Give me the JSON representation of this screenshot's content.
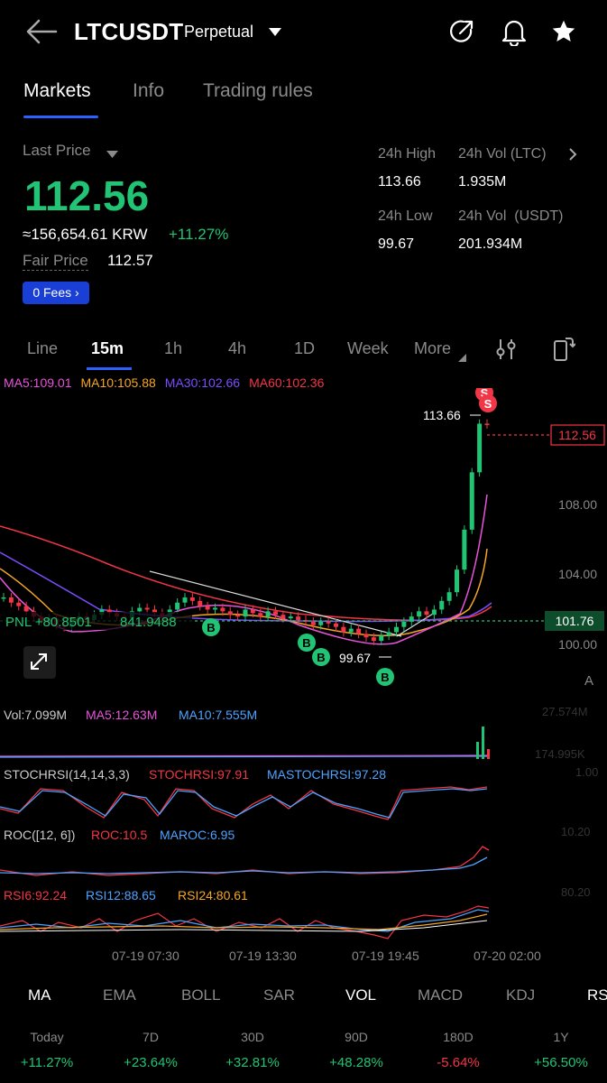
{
  "header": {
    "symbol": "LTCUSDT",
    "contract": "Perpetual"
  },
  "tabs": [
    "Markets",
    "Info",
    "Trading rules"
  ],
  "price": {
    "last_price_label": "Last Price",
    "last": "112.56",
    "krw": "≈156,654.61 KRW",
    "change": "+11.27%",
    "fair_label": "Fair Price",
    "fair": "112.57",
    "fees": "0 Fees"
  },
  "stats": {
    "high_label": "24h High",
    "high": "113.66",
    "vol_ltc_label": "24h Vol (LTC)",
    "vol_ltc": "1.935M",
    "low_label": "24h Low",
    "low": "99.67",
    "vol_usdt_label": "24h Vol  (USDT)",
    "vol_usdt": "201.934M"
  },
  "intervals": [
    "Line",
    "15m",
    "1h",
    "4h",
    "1D",
    "Week",
    "More"
  ],
  "ma_line": {
    "ma5": "MA5:109.01",
    "ma10": "MA10:105.88",
    "ma30": "MA30:102.66",
    "ma60": "MA60:102.36"
  },
  "chart_data": {
    "type": "candlestick",
    "y_ticks": [
      "108.00",
      "104.00",
      "100.00"
    ],
    "high_label": "113.66",
    "low_label": "99.67",
    "last_price_tag": "112.56",
    "pnl_label": "PNL +80.8501",
    "entry_value": "841.9488",
    "entry_price_tag": "101.76",
    "a_label": "A",
    "x_ticks": [
      "07-19 07:30",
      "07-19 13:30",
      "07-19 19:45",
      "07-20 02:00"
    ],
    "buy_marker": "B",
    "sell_marker": "S",
    "closes": [
      102.6,
      102.3,
      102.1,
      101.8,
      101.5,
      101.2,
      101.4,
      101.0,
      100.9,
      101.2,
      101.5,
      101.3,
      101.6,
      101.9,
      101.7,
      101.5,
      101.4,
      101.8,
      102.0,
      101.9,
      101.7,
      101.5,
      101.9,
      102.3,
      102.6,
      102.4,
      102.1,
      101.9,
      102.0,
      101.8,
      101.6,
      101.5,
      101.9,
      101.7,
      101.5,
      101.8,
      101.6,
      101.4,
      101.5,
      101.3,
      101.2,
      101.0,
      101.2,
      101.1,
      100.9,
      100.6,
      100.8,
      100.5,
      100.3,
      100.1,
      100.4,
      100.6,
      100.9,
      101.2,
      101.5,
      101.8,
      101.6,
      101.9,
      102.4,
      102.9,
      104.2,
      106.5,
      109.8,
      112.6,
      112.56
    ]
  },
  "vol": {
    "vol": "Vol:7.099M",
    "ma5": "MA5:12.63M",
    "ma10": "MA10:7.555M",
    "axis_top": "27.574M",
    "axis_mid": "174.995K"
  },
  "stoch": {
    "name": "STOCHRSI(14,14,3,3)",
    "val": "STOCHRSI:97.91",
    "ma": "MASTOCHRSI:97.28",
    "axis": "1.00"
  },
  "roc": {
    "name": "ROC([12, 6])",
    "val": "ROC:10.5",
    "ma": "MAROC:6.95",
    "axis": "10.20"
  },
  "rsi": {
    "r6": "RSI6:92.24",
    "r12": "RSI12:88.65",
    "r24": "RSI24:80.61",
    "axis": "80.20"
  },
  "indicators": [
    "MA",
    "EMA",
    "BOLL",
    "SAR",
    "VOL",
    "MACD",
    "KDJ",
    "RS"
  ],
  "periods": [
    {
      "label": "Today",
      "value": "+11.27%"
    },
    {
      "label": "7D",
      "value": "+23.64%"
    },
    {
      "label": "30D",
      "value": "+32.81%"
    },
    {
      "label": "90D",
      "value": "+48.28%"
    },
    {
      "label": "180D",
      "value": "-5.64%"
    },
    {
      "label": "1Y",
      "value": "+56.50%"
    }
  ],
  "colors": {
    "up": "#21c374",
    "down": "#f23645",
    "ma5": "#e754d9",
    "ma10": "#f5a623",
    "ma30": "#7b4dff",
    "ma60": "#f23645",
    "accent": "#2962ff"
  }
}
